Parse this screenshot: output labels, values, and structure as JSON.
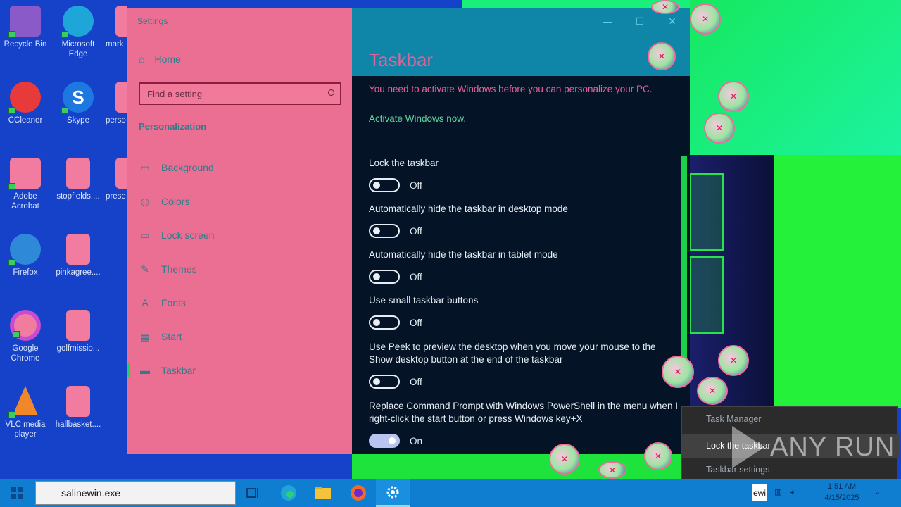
{
  "desktop": {
    "icons": [
      {
        "label": "Recycle Bin",
        "icon": "recycle-bin-icon",
        "color": "#8a5ac8"
      },
      {
        "label": "Microsoft Edge",
        "icon": "edge-icon",
        "color": "#1fa6d8"
      },
      {
        "label": "mark",
        "icon": "excel-file-icon",
        "color": "#f27ca0"
      },
      {
        "label": "CCleaner",
        "icon": "ccleaner-icon",
        "color": "#e83a3a"
      },
      {
        "label": "Skype",
        "icon": "skype-icon",
        "color": "#1d78e0"
      },
      {
        "label": "perso",
        "icon": "file-icon",
        "color": "#f27ca0"
      },
      {
        "label": "Adobe Acrobat",
        "icon": "acrobat-icon",
        "color": "#f27ca0"
      },
      {
        "label": "stopfields....",
        "icon": "image-file-icon",
        "color": "#f27ca0"
      },
      {
        "label": "prese",
        "icon": "excel-file-icon",
        "color": "#f27ca0"
      },
      {
        "label": "Firefox",
        "icon": "firefox-icon",
        "color": "#2e89d8"
      },
      {
        "label": "pinkagree....",
        "icon": "image-file-icon",
        "color": "#f27ca0"
      },
      {
        "label": "Google Chrome",
        "icon": "chrome-icon",
        "color": "#f27ca0"
      },
      {
        "label": "golfmissio...",
        "icon": "excel-file-icon",
        "color": "#f27ca0"
      },
      {
        "label": "VLC media player",
        "icon": "vlc-icon",
        "color": "#f0882a"
      },
      {
        "label": "hallbasket....",
        "icon": "image-file-icon",
        "color": "#f27ca0"
      }
    ]
  },
  "window": {
    "title": "Settings",
    "controls": {
      "minimize": "—",
      "maximize": "☐",
      "close": "✕"
    }
  },
  "nav": {
    "home": "Home",
    "search_placeholder": "Find a setting",
    "section": "Personalization",
    "items": [
      {
        "label": "Background",
        "icon": "image-icon"
      },
      {
        "label": "Colors",
        "icon": "palette-icon"
      },
      {
        "label": "Lock screen",
        "icon": "lock-screen-icon"
      },
      {
        "label": "Themes",
        "icon": "brush-icon"
      },
      {
        "label": "Fonts",
        "icon": "font-icon"
      },
      {
        "label": "Start",
        "icon": "start-icon"
      },
      {
        "label": "Taskbar",
        "icon": "taskbar-icon",
        "active": true
      }
    ]
  },
  "content": {
    "title": "Taskbar",
    "warning": "You need to activate Windows before you can personalize your PC.",
    "activate_link": "Activate Windows now.",
    "settings": [
      {
        "label": "Lock the taskbar",
        "state": "Off"
      },
      {
        "label": "Automatically hide the taskbar in desktop mode",
        "state": "Off"
      },
      {
        "label": "Automatically hide the taskbar in tablet mode",
        "state": "Off"
      },
      {
        "label": "Use small taskbar buttons",
        "state": "Off"
      },
      {
        "label": "Use Peek to preview the desktop when you move your mouse to the Show desktop button at the end of the taskbar",
        "state": "Off"
      },
      {
        "label": "Replace Command Prompt with Windows PowerShell in the menu when I right-click the start button or press Windows key+X",
        "state": "On"
      }
    ]
  },
  "context_menu": {
    "items": [
      "Task Manager",
      "Lock the taskbar",
      "Taskbar settings"
    ]
  },
  "watermark": "ANY RUN",
  "taskbar": {
    "search_value": "salinewin.exe",
    "apps": [
      "task-view-icon",
      "edge-icon",
      "file-explorer-icon",
      "firefox-icon",
      "settings-icon"
    ],
    "tray_label": "ewi",
    "time": "1:51 AM",
    "date": "4/15/2025"
  }
}
